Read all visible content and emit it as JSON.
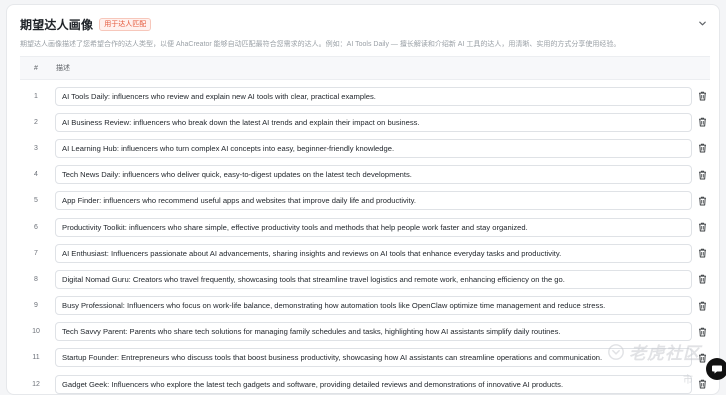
{
  "section": {
    "title": "期望达人画像",
    "badge": "用于达人匹配",
    "description": "期望达人画像描述了您希望合作的达人类型，以便 AhaCreator 能够自动匹配最符合您需求的达人。例如：AI Tools Daily — 擅长解读和介绍新 AI 工具的达人，用清晰、实用的方式分享使用经验。"
  },
  "table": {
    "headers": {
      "index": "#",
      "description": "描述"
    },
    "rows": [
      {
        "index": "1",
        "value": "AI Tools Daily: influencers who review and explain new AI tools with clear, practical examples."
      },
      {
        "index": "2",
        "value": "AI Business Review: influencers who break down the latest AI trends and explain their impact on business."
      },
      {
        "index": "3",
        "value": "AI Learning Hub: influencers who turn complex AI concepts into easy, beginner-friendly knowledge."
      },
      {
        "index": "4",
        "value": "Tech News Daily: influencers who deliver quick, easy-to-digest updates on the latest tech developments."
      },
      {
        "index": "5",
        "value": "App Finder: influencers who recommend useful apps and websites that improve daily life and productivity."
      },
      {
        "index": "6",
        "value": "Productivity Toolkit: influencers who share simple, effective productivity tools and methods that help people work faster and stay organized."
      },
      {
        "index": "7",
        "value": "AI Enthusiast: Influencers passionate about AI advancements, sharing insights and reviews on AI tools that enhance everyday tasks and productivity."
      },
      {
        "index": "8",
        "value": "Digital Nomad Guru: Creators who travel frequently, showcasing tools that streamline travel logistics and remote work, enhancing efficiency on the go."
      },
      {
        "index": "9",
        "value": "Busy Professional: Influencers who focus on work-life balance, demonstrating how automation tools like OpenClaw optimize time management and reduce stress."
      },
      {
        "index": "10",
        "value": "Tech Savvy Parent: Parents who share tech solutions for managing family schedules and tasks, highlighting how AI assistants simplify daily routines."
      },
      {
        "index": "11",
        "value": "Startup Founder: Entrepreneurs who discuss tools that boost business productivity, showcasing how AI assistants can streamline operations and communication."
      },
      {
        "index": "12",
        "value": "Gadget Geek: Influencers who explore the latest tech gadgets and software, providing detailed reviews and demonstrations of innovative AI products."
      }
    ]
  },
  "icons": {
    "collapse": "chevron-down-icon",
    "delete": "trash-icon",
    "chat": "chat-icon"
  },
  "watermark": {
    "brand": "老虎社区",
    "sub": "市"
  },
  "colors": {
    "badge_text": "#e4583a",
    "badge_bg": "#fff1ee",
    "border": "#dfe2e6",
    "fab": "#111111"
  }
}
